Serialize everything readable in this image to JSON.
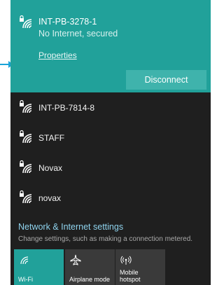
{
  "colors": {
    "accent": "#21a19a",
    "flyout_bg": "#1f1f1f",
    "link": "#8fd3ee",
    "tile_inactive": "#3a3a3a"
  },
  "active_network": {
    "name": "INT-PB-3278-1",
    "status": "No Internet, secured",
    "properties_label": "Properties",
    "disconnect_label": "Disconnect",
    "icon": "wifi-secured-icon"
  },
  "networks": [
    {
      "name": "INT-PB-7814-8",
      "icon": "wifi-secured-icon"
    },
    {
      "name": "STAFF",
      "icon": "wifi-secured-icon"
    },
    {
      "name": "Novax",
      "icon": "wifi-secured-icon"
    },
    {
      "name": "novax",
      "icon": "wifi-secured-icon"
    }
  ],
  "settings": {
    "title": "Network & Internet settings",
    "description": "Change settings, such as making a connection metered."
  },
  "quick_actions": [
    {
      "label": "Wi-Fi",
      "icon": "wifi-icon",
      "active": true
    },
    {
      "label": "Airplane mode",
      "icon": "airplane-icon",
      "active": false
    },
    {
      "label": "Mobile\nhotspot",
      "icon": "hotspot-icon",
      "active": false
    }
  ]
}
